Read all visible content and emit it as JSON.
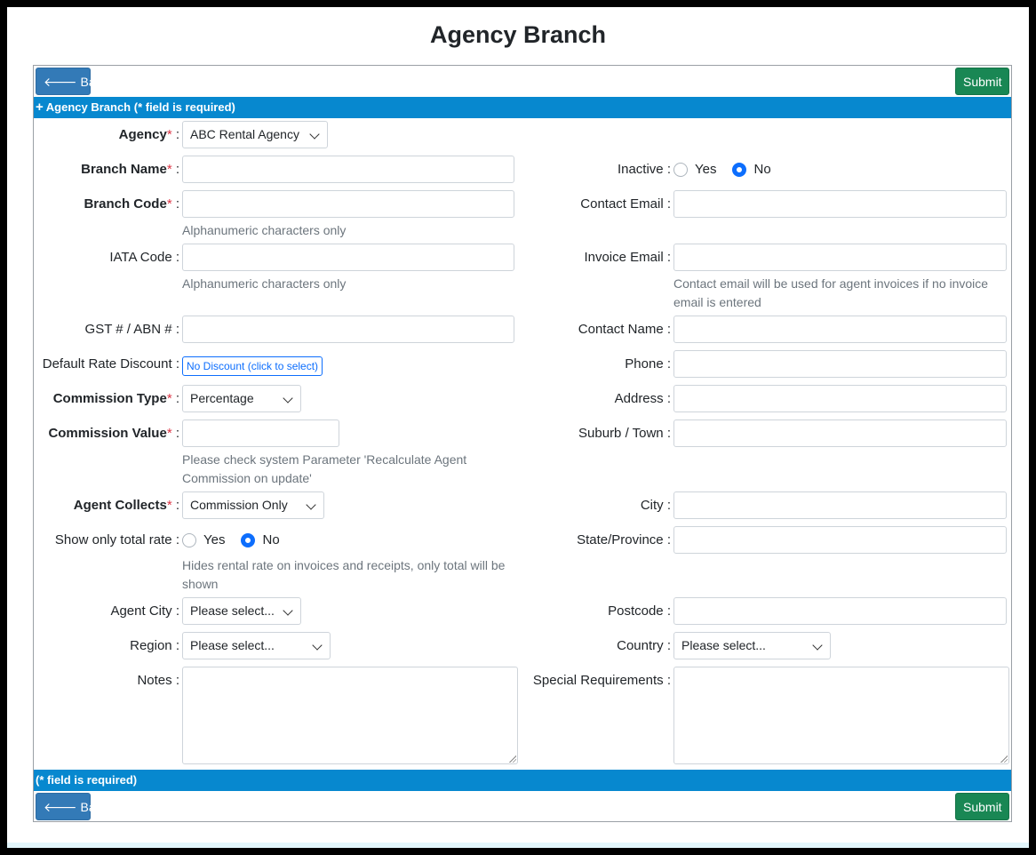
{
  "page": {
    "title": "Agency Branch"
  },
  "toolbar": {
    "back_label": "Back",
    "submit_label": "Submit"
  },
  "header_band": "Agency Branch (* field is required)",
  "footer_band": "(* field is required)",
  "req_mark": "*",
  "colon": ":",
  "left": {
    "agency": {
      "label": "Agency",
      "value": "ABC Rental Agency"
    },
    "branch_name": {
      "label": "Branch Name",
      "value": ""
    },
    "branch_code": {
      "label": "Branch Code",
      "value": "",
      "hint": "Alphanumeric characters only"
    },
    "iata_code": {
      "label": "IATA Code",
      "value": "",
      "hint": "Alphanumeric characters only"
    },
    "gst": {
      "label": "GST # / ABN #",
      "value": ""
    },
    "rate_discount": {
      "label": "Default Rate Discount",
      "button": "No Discount (click to select)"
    },
    "commission_type": {
      "label": "Commission Type",
      "value": "Percentage"
    },
    "commission_value": {
      "label": "Commission Value",
      "value": "",
      "hint": "Please check system Parameter 'Recalculate Agent Commission on update'"
    },
    "agent_collects": {
      "label": "Agent Collects",
      "value": "Commission Only"
    },
    "show_total": {
      "label": "Show only total rate",
      "yes": "Yes",
      "no": "No",
      "selected": "No",
      "hint": "Hides rental rate on invoices and receipts, only total will be shown"
    },
    "agent_city": {
      "label": "Agent City",
      "value": "Please select..."
    },
    "region": {
      "label": "Region",
      "value": "Please select..."
    },
    "notes": {
      "label": "Notes",
      "value": ""
    }
  },
  "right": {
    "inactive": {
      "label": "Inactive",
      "yes": "Yes",
      "no": "No",
      "selected": "No"
    },
    "contact_email": {
      "label": "Contact Email",
      "value": ""
    },
    "invoice_email": {
      "label": "Invoice Email",
      "value": "",
      "hint": "Contact email will be used for agent invoices if no invoice email is entered"
    },
    "contact_name": {
      "label": "Contact Name",
      "value": ""
    },
    "phone": {
      "label": "Phone",
      "value": ""
    },
    "address": {
      "label": "Address",
      "value": ""
    },
    "suburb": {
      "label": "Suburb / Town",
      "value": ""
    },
    "city": {
      "label": "City",
      "value": ""
    },
    "state": {
      "label": "State/Province",
      "value": ""
    },
    "postcode": {
      "label": "Postcode",
      "value": ""
    },
    "country": {
      "label": "Country",
      "value": "Please select..."
    },
    "special": {
      "label": "Special Requirements",
      "value": ""
    }
  },
  "colors": {
    "band": "#0788cf",
    "back": "#337ab7",
    "submit": "#198754",
    "required": "#dc3545",
    "radio": "#0d6efd"
  }
}
